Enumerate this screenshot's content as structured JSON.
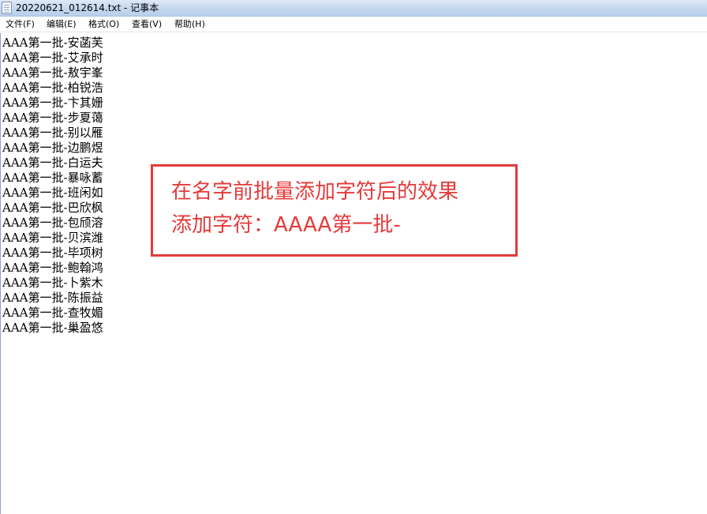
{
  "window": {
    "title": "20220621_012614.txt - 记事本",
    "icon": "notepad-icon"
  },
  "menu": [
    {
      "label": "文件(F)"
    },
    {
      "label": "编辑(E)"
    },
    {
      "label": "格式(O)"
    },
    {
      "label": "查看(V)"
    },
    {
      "label": "帮助(H)"
    }
  ],
  "editor": {
    "lines": [
      "AAA第一批-安菡芙",
      "AAA第一批-艾承时",
      "AAA第一批-敖宇峯",
      "AAA第一批-柏锐浩",
      "AAA第一批-卞其姗",
      "AAA第一批-步夏蔼",
      "AAA第一批-别以雁",
      "AAA第一批-边鹏煜",
      "AAA第一批-白运夫",
      "AAA第一批-暴咏蓄",
      "AAA第一批-班闲如",
      "AAA第一批-巴欣枫",
      "AAA第一批-包颀溶",
      "AAA第一批-贝滨潍",
      "AAA第一批-毕项树",
      "AAA第一批-鲍翰鸿",
      "AAA第一批-卜紫木",
      "AAA第一批-陈振益",
      "AAA第一批-查牧媚",
      "AAA第一批-巢盈悠"
    ]
  },
  "annotation": {
    "line1": "在名字前批量添加字符后的效果",
    "line2": "添加字符：AAAA第一批-",
    "color": "#e53a3a"
  }
}
